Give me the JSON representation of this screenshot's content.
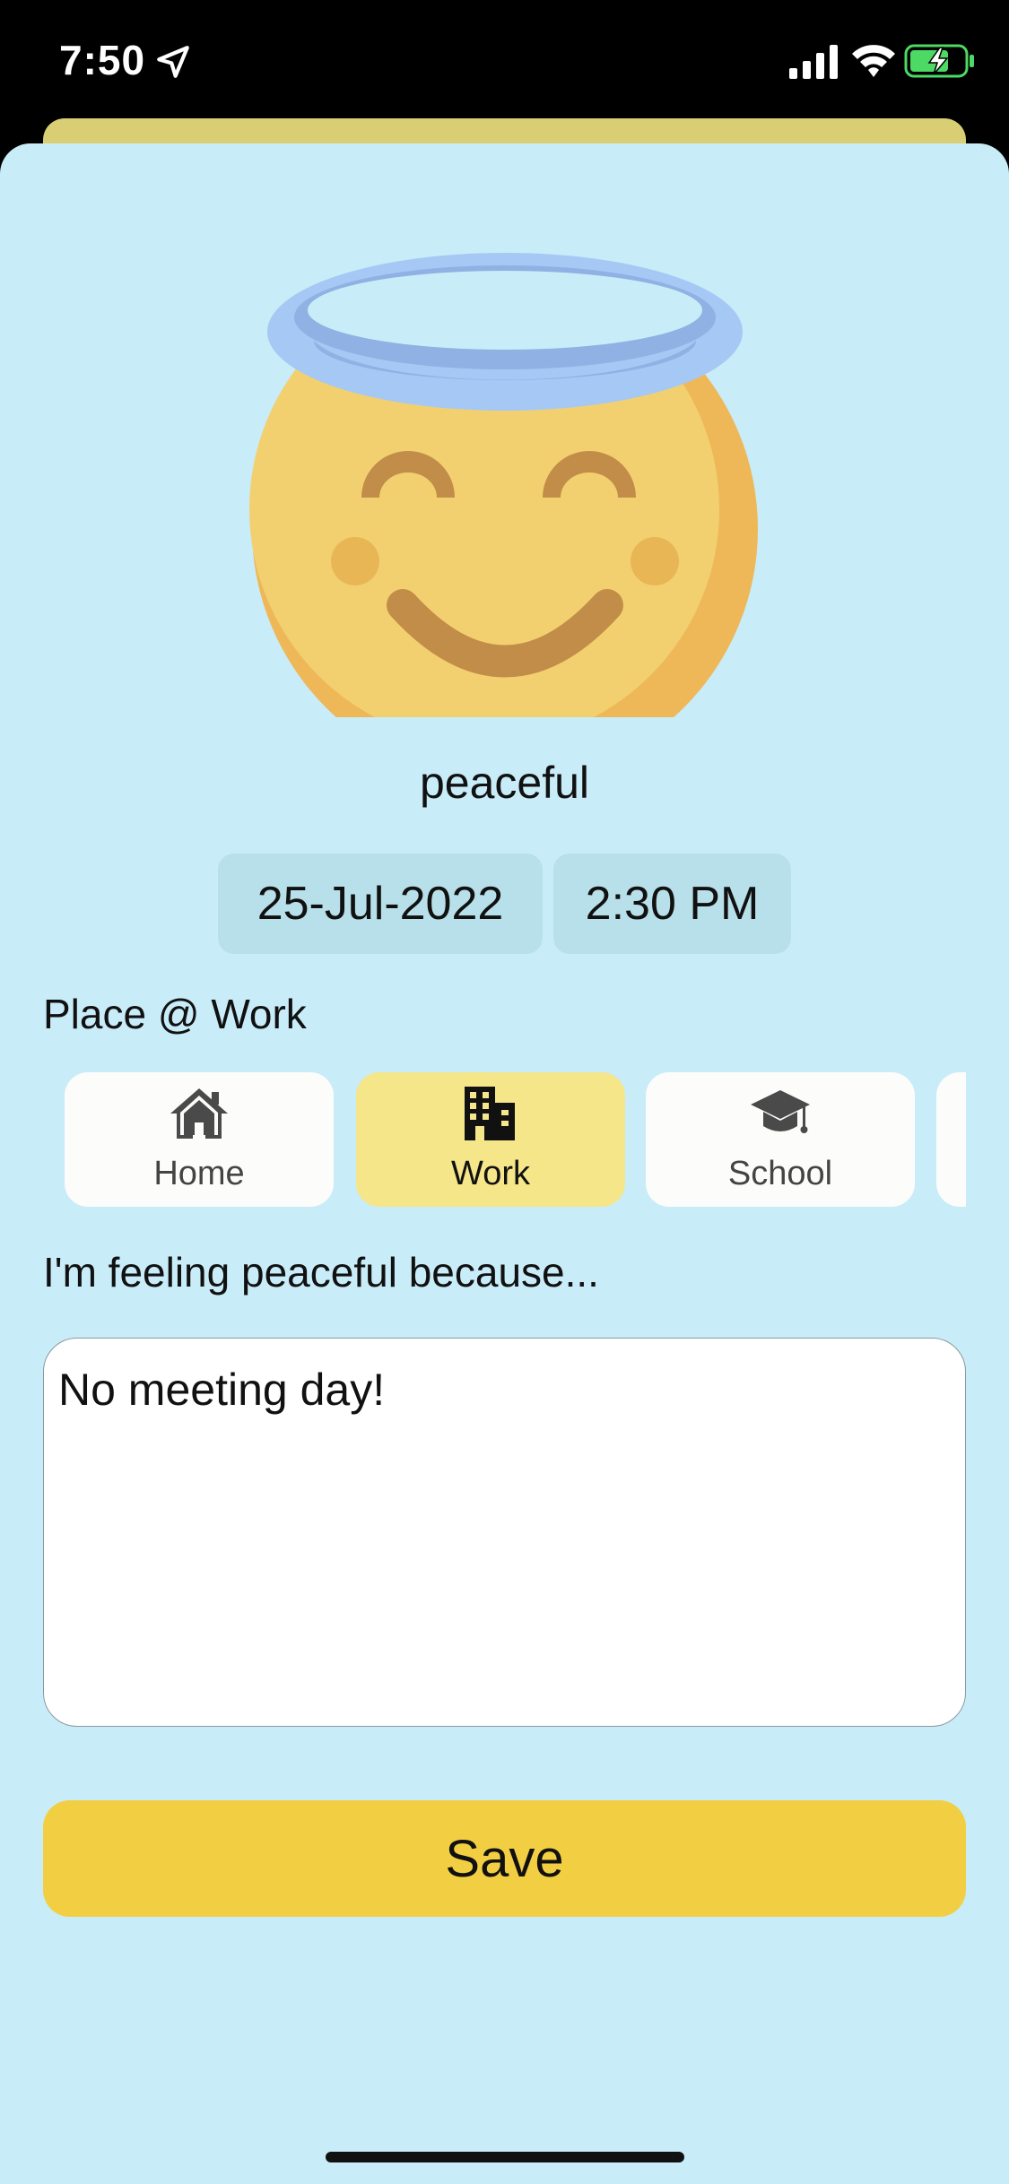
{
  "status_bar": {
    "time": "7:50"
  },
  "mood": {
    "label": "peaceful",
    "emoji_icon": "angel-smiley-icon"
  },
  "datetime": {
    "date": "25-Jul-2022",
    "time": "2:30 PM"
  },
  "place": {
    "heading": "Place @ Work",
    "options": [
      {
        "label": "Home",
        "icon": "house-icon",
        "selected": false
      },
      {
        "label": "Work",
        "icon": "building-icon",
        "selected": true
      },
      {
        "label": "School",
        "icon": "graduation-cap-icon",
        "selected": false
      }
    ]
  },
  "reason": {
    "heading": "I'm feeling peaceful because...",
    "text": "No meeting day!"
  },
  "actions": {
    "save_label": "Save"
  },
  "colors": {
    "background": "#c8ecf8",
    "accent": "#f2cf42",
    "selected_card": "#f5e68a"
  }
}
